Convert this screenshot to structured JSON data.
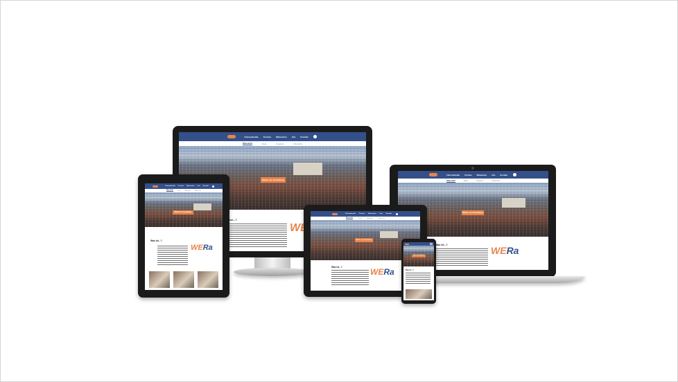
{
  "site": {
    "brand_part1": "WE",
    "brand_part2": "Ra",
    "cta_label": "Weiter zur Anmeldung",
    "nav": [
      "Fahrradstraße",
      "Termine",
      "Mitmachen",
      "Info",
      "Kontakt"
    ],
    "subnav": [
      "Übersicht",
      "Ziele",
      "Angebot",
      "Übersicht"
    ],
    "intro_title": "Was ist...?",
    "colors": {
      "nav": "#34508a",
      "accent": "#e8844a",
      "frame": "#1c1c1c"
    }
  }
}
